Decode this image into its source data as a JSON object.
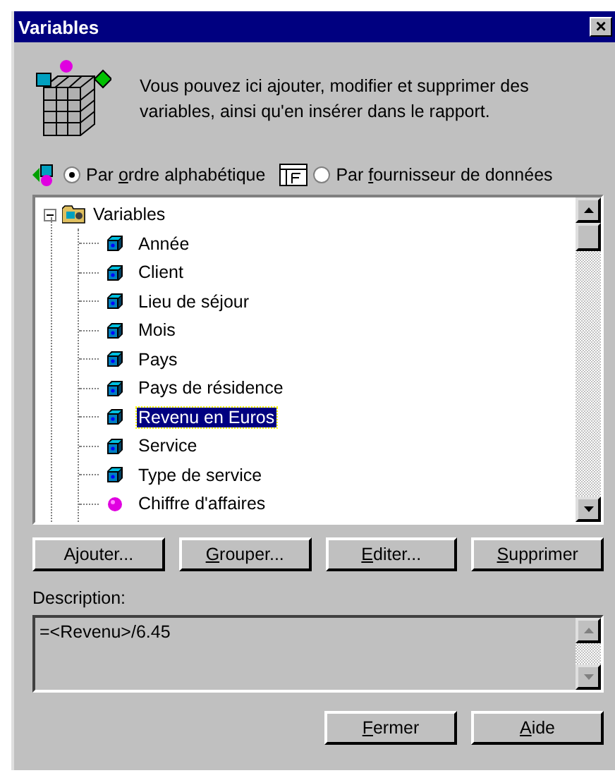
{
  "window": {
    "title": "Variables",
    "close": "×"
  },
  "intro": "Vous pouvez ici ajouter, modifier et supprimer des variables, ainsi qu'en insérer dans le rapport.",
  "sort_options": [
    {
      "pre": "Par ",
      "key": "o",
      "post": "rdre alphabétique",
      "selected": true
    },
    {
      "pre": "Par ",
      "key": "f",
      "post": "ournisseur de données",
      "selected": false
    }
  ],
  "tree": {
    "label": "Variables",
    "expanded": true,
    "children": [
      {
        "label": "Année",
        "kind": "dimension",
        "selected": false
      },
      {
        "label": "Client",
        "kind": "dimension",
        "selected": false
      },
      {
        "label": "Lieu de séjour",
        "kind": "dimension",
        "selected": false
      },
      {
        "label": "Mois",
        "kind": "dimension",
        "selected": false
      },
      {
        "label": "Pays",
        "kind": "dimension",
        "selected": false
      },
      {
        "label": "Pays de résidence",
        "kind": "dimension",
        "selected": false
      },
      {
        "label": "Revenu en Euros",
        "kind": "dimension",
        "selected": true
      },
      {
        "label": "Service",
        "kind": "dimension",
        "selected": false
      },
      {
        "label": "Type de service",
        "kind": "dimension",
        "selected": false
      },
      {
        "label": "Chiffre d'affaires",
        "kind": "measure",
        "selected": false
      }
    ]
  },
  "actions": [
    {
      "post": "Ajouter..."
    },
    {
      "key": "G",
      "post": "rouper..."
    },
    {
      "key": "E",
      "post": "diter..."
    },
    {
      "key": "S",
      "post": "upprimer"
    }
  ],
  "description": {
    "label": "Description:",
    "value": "=<Revenu>/6.45"
  },
  "footer_buttons": [
    {
      "key": "F",
      "post": "ermer"
    },
    {
      "key": "A",
      "post": "ide"
    }
  ]
}
